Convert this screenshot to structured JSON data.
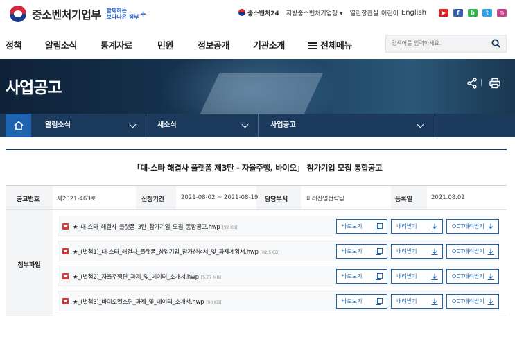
{
  "header": {
    "logo_name": "중소벤처기업부",
    "logo_sub_line1": "함께하는",
    "logo_sub_line2": "보다나은 정부",
    "top_links": {
      "mss24": "중소벤처24",
      "regional": "지방중소벤처기업청",
      "open_office": "열린장관실",
      "kids": "어린이",
      "english": "English"
    },
    "sns": [
      {
        "name": "youtube-icon",
        "color": "#e02020",
        "glyph": "▶"
      },
      {
        "name": "facebook-icon",
        "color": "#3b5bb0",
        "glyph": "f"
      },
      {
        "name": "blog-icon",
        "color": "#2db34a",
        "glyph": "b"
      },
      {
        "name": "twitter-icon",
        "color": "#2aa3e6",
        "glyph": "t"
      },
      {
        "name": "instagram-icon",
        "color": "#c83f8c",
        "glyph": "◎"
      }
    ]
  },
  "nav": {
    "items": [
      "정책",
      "알림소식",
      "통계자료",
      "민원",
      "정보공개",
      "기관소개"
    ],
    "all_menu": "전체메뉴",
    "search_placeholder": "검색어를 입력하세요."
  },
  "banner": {
    "title": "사업공고"
  },
  "breadcrumb": [
    "알림소식",
    "새소식",
    "사업공고"
  ],
  "post": {
    "title": "「대-스타 해결사 플랫폼 제3탄 - 자율주행, 바이오」 참가기업 모집 통합공고",
    "info": {
      "no_label": "공고번호",
      "no_value": "제2021-463호",
      "period_label": "신청기간",
      "period_value": "2021-08-02 ~ 2021-08-19",
      "dept_label": "담당부서",
      "dept_value": "미래산업전략팀",
      "date_label": "등록일",
      "date_value": "2021.08.02"
    },
    "attach_label": "첨부파일",
    "files": [
      {
        "name": "★_대-스타_해결사_플랫폼_3탄_참가기업_모집_통합공고.hwp",
        "size": "[92 KB]"
      },
      {
        "name": "★_(별첨1)_대-스타_해결사_플랫폼_창업기업_참가신청서_및_과제계획서.hwp",
        "size": "[82.5 KB]"
      },
      {
        "name": "★_(별첨2)_자율주행편_과제_및_데이터_소개서.hwp",
        "size": "[5.77 MB]"
      },
      {
        "name": "★_(별첨3)_바이오헬스편_과제_및_데이터_소개서.hwp",
        "size": "[80 KB]"
      }
    ],
    "buttons": {
      "view": "바로보기",
      "download": "내려받기",
      "odt": "ODT내려받기"
    }
  }
}
